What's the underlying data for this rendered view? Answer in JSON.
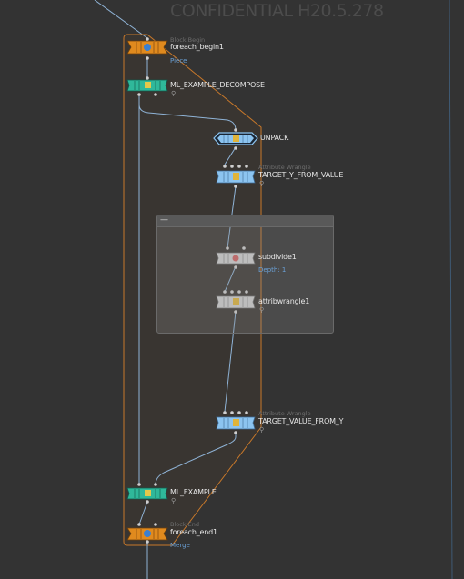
{
  "watermark": "CONFIDENTIAL H20.5.278",
  "colors": {
    "background": "#333333",
    "block_outline": "#c8782a",
    "block_node": "#e08a1e",
    "ml_node": "#2fb89a",
    "wrangle_node": "#8cc4f0",
    "unpack_node": "#8cc4f0",
    "neutral_node": "#c8c8c8",
    "wire": "#8fb3d6",
    "info_text": "#6aa0d6"
  },
  "nodes": {
    "foreach_begin": {
      "type_label": "Block Begin",
      "name": "foreach_begin1",
      "info": "Piece",
      "icon": "loop-begin-icon"
    },
    "ml_decompose": {
      "name": "ML_EXAMPLE_DECOMPOSE",
      "icon": "ml-example-icon"
    },
    "unpack": {
      "name": "UNPACK",
      "icon": "unpack-icon"
    },
    "target_y": {
      "type_label": "Attribute Wrangle",
      "name": "TARGET_Y_FROM_VALUE",
      "icon": "wrangle-icon"
    },
    "subdivide": {
      "name": "subdivide1",
      "info": "Depth: 1",
      "icon": "subdivide-icon"
    },
    "attribwrangle": {
      "name": "attribwrangle1",
      "icon": "wrangle-icon"
    },
    "target_value": {
      "type_label": "Attribute Wrangle",
      "name": "TARGET_VALUE_FROM_Y",
      "icon": "wrangle-icon"
    },
    "ml_example": {
      "name": "ML_EXAMPLE",
      "icon": "ml-example-icon"
    },
    "foreach_end": {
      "type_label": "Block End",
      "name": "foreach_end1",
      "info": "Merge",
      "icon": "loop-end-icon"
    }
  },
  "netbox": {
    "collapse_glyph": "—"
  },
  "badge_glyph": "⚲"
}
